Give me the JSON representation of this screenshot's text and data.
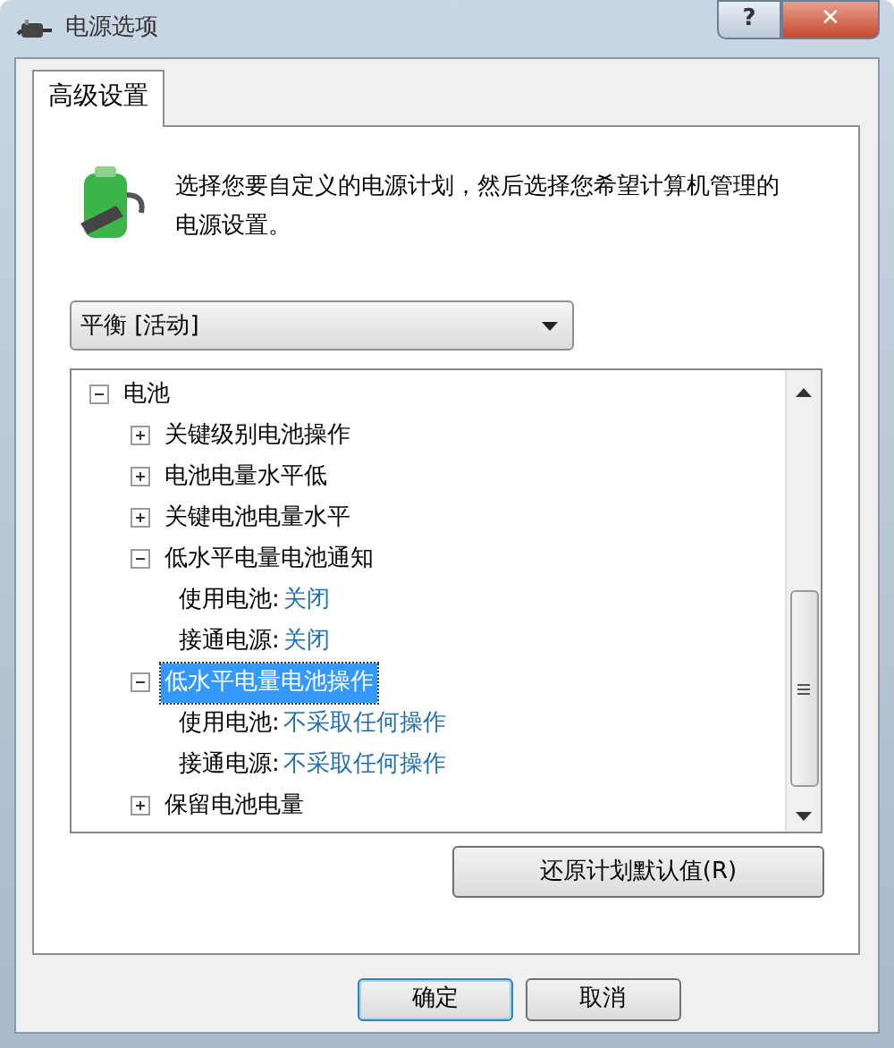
{
  "window": {
    "title": "电源选项",
    "help_button": "?",
    "close_button": "✕"
  },
  "tabs": [
    {
      "label": "高级设置",
      "selected": true
    }
  ],
  "intro": "选择您要自定义的电源计划，然后选择您希望计算机管理的电源设置。",
  "plan_dropdown": {
    "value": "平衡 [活动]"
  },
  "tree": [
    {
      "kind": "group",
      "label": "电池",
      "expanded": true,
      "selected": false,
      "children": [
        {
          "kind": "group",
          "label": "关键级别电池操作",
          "expanded": false,
          "selected": false
        },
        {
          "kind": "group",
          "label": "电池电量水平低",
          "expanded": false,
          "selected": false
        },
        {
          "kind": "group",
          "label": "关键电池电量水平",
          "expanded": false,
          "selected": false
        },
        {
          "kind": "group",
          "label": "低水平电量电池通知",
          "expanded": true,
          "selected": false,
          "children": [
            {
              "kind": "setting",
              "label": "使用电池:",
              "value": "关闭",
              "selected": false
            },
            {
              "kind": "setting",
              "label": "接通电源:",
              "value": "关闭",
              "selected": false
            }
          ]
        },
        {
          "kind": "group",
          "label": "低水平电量电池操作",
          "expanded": true,
          "selected": true,
          "children": [
            {
              "kind": "setting",
              "label": "使用电池:",
              "value": "不采取任何操作",
              "selected": false
            },
            {
              "kind": "setting",
              "label": "接通电源:",
              "value": "不采取任何操作",
              "selected": false
            }
          ]
        },
        {
          "kind": "group",
          "label": "保留电池电量",
          "expanded": false,
          "selected": false
        }
      ]
    }
  ],
  "restore_button": "还原计划默认值(R)",
  "buttons": [
    {
      "label": "确定",
      "default": true
    },
    {
      "label": "取消",
      "default": false
    }
  ]
}
